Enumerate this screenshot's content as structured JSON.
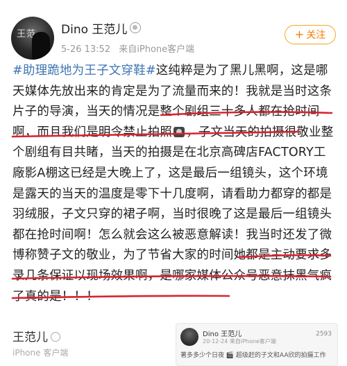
{
  "user": {
    "name": "Dino 王范儿",
    "verified_icon": "medal-badge-icon"
  },
  "meta": {
    "date": "5-26 13:52",
    "source": "来自iPhone客户端"
  },
  "follow_button": {
    "label": "关注",
    "icon": "plus-icon",
    "accent": "#f57b00"
  },
  "post": {
    "hashtag": "#助理跪地为王子文穿鞋#",
    "segments": [
      "这纯粹是为了黑儿黑啊，这是哪天媒体先放出来的肯定是为了流量而来的！我就是当时这条片子的导演，",
      "当天的情况是整个剧组三十多人都在抢时间啊，而且我们是明令禁止拍照",
      "，子文当天的拍摄很敬业整个剧组有目共睹，当天的拍摄是在北京高碑店FACTORY工廠影A棚这已经是大晚上了，这是最后一组镜头，这个环境是露天的当天的温度是零下十几度啊，请看助力都穿的都是羽绒服，子文只穿的裙子啊，当时很晚了这是最后一组镜头都在抢时间啊！怎么就会这么被恶意解读！",
      "我当时还发了微博称赞子文的敬业，为了节省大家的时间她都是主动要求多录几条保证以现场效果啊，",
      "是哪家媒体公众号恶意抹黑气疯了真的是！！！"
    ],
    "emoji_icon": "camera-icon",
    "hashtag_color": "#3f76b2",
    "underline_color": "#d9232d"
  },
  "repost": {
    "name": "王范儿",
    "badge_icon": "medal-badge-icon",
    "sub": "iPhone 客户端",
    "card": {
      "name": "Dino 王范儿",
      "meta": "20-12-24 来自iPhone客户端",
      "count": "2593",
      "text": "著多多少个日夜 🎬 超级赶的子文和AA欣的拍摄工作"
    }
  }
}
